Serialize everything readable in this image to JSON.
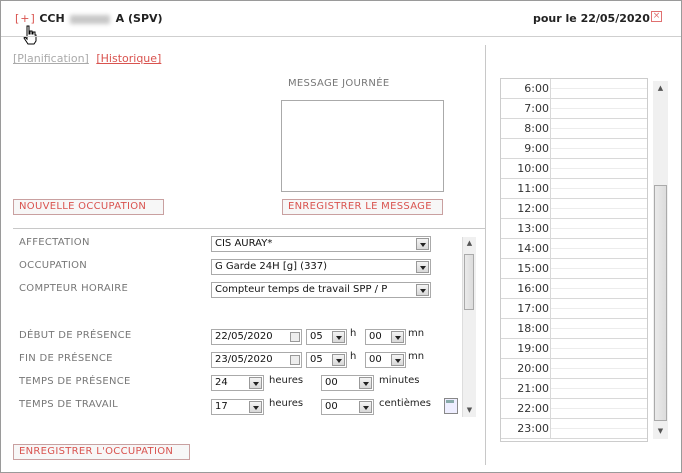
{
  "header": {
    "expand_label": "[+]",
    "title_prefix": "CCH",
    "title_suffix": "A (SPV)",
    "date_label": "pour le 22/05/2020",
    "close_label": "×"
  },
  "tabs": [
    {
      "label": "[Planification]",
      "active": false
    },
    {
      "label": "[Historique]",
      "active": true
    }
  ],
  "message": {
    "title": "MESSAGE JOURNÉE",
    "value": "",
    "save_button": "ENREGISTRER LE MESSAGE"
  },
  "new_occupation_button": "NOUVELLE OCCUPATION",
  "form": {
    "affectation": {
      "label": "AFFECTATION",
      "value": "CIS AURAY*"
    },
    "occupation": {
      "label": "OCCUPATION",
      "value": "G Garde 24H [g] (337)"
    },
    "compteur": {
      "label": "COMPTEUR HORAIRE",
      "value": "Compteur temps de travail SPP / P"
    },
    "debut": {
      "label": "DÉBUT DE PRÉSENCE",
      "date": "22/05/2020",
      "hour": "05",
      "hour_unit": "h",
      "minute": "00",
      "minute_unit": "mn"
    },
    "fin": {
      "label": "FIN DE PRÉSENCE",
      "date": "23/05/2020",
      "hour": "05",
      "hour_unit": "h",
      "minute": "00",
      "minute_unit": "mn"
    },
    "temps_presence": {
      "label": "TEMPS DE PRÉSENCE",
      "hours": "24",
      "hours_unit": "heures",
      "minutes": "00",
      "minutes_unit": "minutes"
    },
    "temps_travail": {
      "label": "TEMPS DE TRAVAIL",
      "hours": "17",
      "hours_unit": "heures",
      "hundredths": "00",
      "hundredths_unit": "centièmes"
    }
  },
  "save_occupation_button": "ENREGISTRER L'OCCUPATION",
  "schedule": {
    "hours": [
      "6:00",
      "7:00",
      "8:00",
      "9:00",
      "10:00",
      "11:00",
      "12:00",
      "13:00",
      "14:00",
      "15:00",
      "16:00",
      "17:00",
      "18:00",
      "19:00",
      "20:00",
      "21:00",
      "22:00",
      "23:00"
    ]
  },
  "colors": {
    "accent": "#d9534f",
    "border": "#9a9a9a"
  },
  "icons": [
    "expand-icon",
    "close-icon",
    "cursor-hand-icon",
    "dropdown-arrow-icon",
    "calendar-icon",
    "calculator-icon"
  ]
}
